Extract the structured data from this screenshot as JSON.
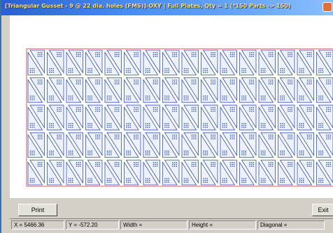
{
  "window": {
    "title": "[Triangular Gusset - 9 @ 22 dia. holes (FMS)]-OXY | Full Plates, Qty = 1 (*150 Parts -> 150)"
  },
  "nest": {
    "columns": 16,
    "rows": 5,
    "plate_border_color": "#e05050",
    "part_color": "#3050b8",
    "hole_grid": 3
  },
  "buttons": {
    "print": "Print",
    "exit": "Exit"
  },
  "status": {
    "x": "X = 5466.36",
    "y": "Y = -572.20",
    "width": "Width =",
    "height": "Height =",
    "diagonal": "Diagonal ="
  }
}
